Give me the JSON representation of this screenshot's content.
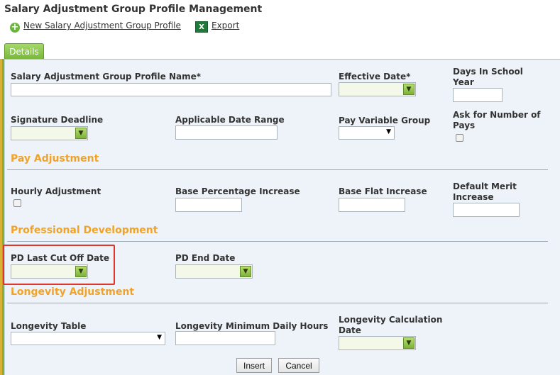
{
  "page_title": "Salary Adjustment Group Profile Management",
  "toolbar": {
    "new_profile_label": "New Salary Adjustment Group Profile",
    "new_profile_icon": "plus-circle-icon",
    "export_label": "Export",
    "export_icon": "excel-icon"
  },
  "tabs": {
    "details": "Details"
  },
  "fields": {
    "profile_name": "Salary Adjustment Group Profile Name*",
    "effective_date": "Effective Date*",
    "days_in_school_year": "Days In School Year",
    "signature_deadline": "Signature Deadline",
    "applicable_date_range": "Applicable Date Range",
    "pay_variable_group": "Pay Variable Group",
    "ask_number_of_pays": "Ask for Number of Pays",
    "hourly_adjustment": "Hourly Adjustment",
    "base_percentage_increase": "Base Percentage Increase",
    "base_flat_increase": "Base Flat Increase",
    "default_merit_increase": "Default Merit Increase",
    "pd_last_cut_off_date": "PD Last Cut Off Date",
    "pd_end_date": "PD End Date",
    "longevity_table": "Longevity Table",
    "longevity_min_daily_hours": "Longevity Minimum Daily Hours",
    "longevity_calculation_date": "Longevity Calculation Date"
  },
  "sections": {
    "pay_adjustment": "Pay Adjustment",
    "professional_development": "Professional Development",
    "longevity_adjustment": "Longevity Adjustment"
  },
  "buttons": {
    "insert": "Insert",
    "cancel": "Cancel"
  },
  "colors": {
    "section_title": "#f0a328",
    "tab_green": "#78b83a",
    "panel_bg": "#edf3f8",
    "highlight": "#e0352b"
  }
}
